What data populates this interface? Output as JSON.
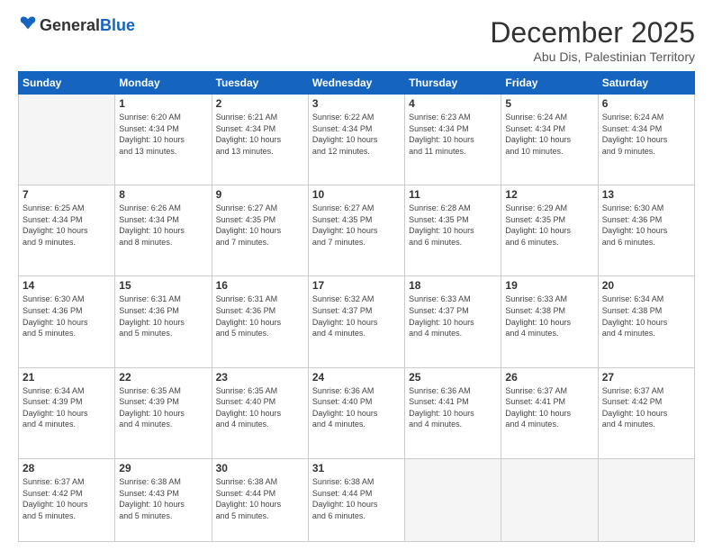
{
  "header": {
    "logo_general": "General",
    "logo_blue": "Blue",
    "month_title": "December 2025",
    "location": "Abu Dis, Palestinian Territory"
  },
  "days_of_week": [
    "Sunday",
    "Monday",
    "Tuesday",
    "Wednesday",
    "Thursday",
    "Friday",
    "Saturday"
  ],
  "weeks": [
    [
      {
        "day": "",
        "info": ""
      },
      {
        "day": "1",
        "info": "Sunrise: 6:20 AM\nSunset: 4:34 PM\nDaylight: 10 hours\nand 13 minutes."
      },
      {
        "day": "2",
        "info": "Sunrise: 6:21 AM\nSunset: 4:34 PM\nDaylight: 10 hours\nand 13 minutes."
      },
      {
        "day": "3",
        "info": "Sunrise: 6:22 AM\nSunset: 4:34 PM\nDaylight: 10 hours\nand 12 minutes."
      },
      {
        "day": "4",
        "info": "Sunrise: 6:23 AM\nSunset: 4:34 PM\nDaylight: 10 hours\nand 11 minutes."
      },
      {
        "day": "5",
        "info": "Sunrise: 6:24 AM\nSunset: 4:34 PM\nDaylight: 10 hours\nand 10 minutes."
      },
      {
        "day": "6",
        "info": "Sunrise: 6:24 AM\nSunset: 4:34 PM\nDaylight: 10 hours\nand 9 minutes."
      }
    ],
    [
      {
        "day": "7",
        "info": "Sunrise: 6:25 AM\nSunset: 4:34 PM\nDaylight: 10 hours\nand 9 minutes."
      },
      {
        "day": "8",
        "info": "Sunrise: 6:26 AM\nSunset: 4:34 PM\nDaylight: 10 hours\nand 8 minutes."
      },
      {
        "day": "9",
        "info": "Sunrise: 6:27 AM\nSunset: 4:35 PM\nDaylight: 10 hours\nand 7 minutes."
      },
      {
        "day": "10",
        "info": "Sunrise: 6:27 AM\nSunset: 4:35 PM\nDaylight: 10 hours\nand 7 minutes."
      },
      {
        "day": "11",
        "info": "Sunrise: 6:28 AM\nSunset: 4:35 PM\nDaylight: 10 hours\nand 6 minutes."
      },
      {
        "day": "12",
        "info": "Sunrise: 6:29 AM\nSunset: 4:35 PM\nDaylight: 10 hours\nand 6 minutes."
      },
      {
        "day": "13",
        "info": "Sunrise: 6:30 AM\nSunset: 4:36 PM\nDaylight: 10 hours\nand 6 minutes."
      }
    ],
    [
      {
        "day": "14",
        "info": "Sunrise: 6:30 AM\nSunset: 4:36 PM\nDaylight: 10 hours\nand 5 minutes."
      },
      {
        "day": "15",
        "info": "Sunrise: 6:31 AM\nSunset: 4:36 PM\nDaylight: 10 hours\nand 5 minutes."
      },
      {
        "day": "16",
        "info": "Sunrise: 6:31 AM\nSunset: 4:36 PM\nDaylight: 10 hours\nand 5 minutes."
      },
      {
        "day": "17",
        "info": "Sunrise: 6:32 AM\nSunset: 4:37 PM\nDaylight: 10 hours\nand 4 minutes."
      },
      {
        "day": "18",
        "info": "Sunrise: 6:33 AM\nSunset: 4:37 PM\nDaylight: 10 hours\nand 4 minutes."
      },
      {
        "day": "19",
        "info": "Sunrise: 6:33 AM\nSunset: 4:38 PM\nDaylight: 10 hours\nand 4 minutes."
      },
      {
        "day": "20",
        "info": "Sunrise: 6:34 AM\nSunset: 4:38 PM\nDaylight: 10 hours\nand 4 minutes."
      }
    ],
    [
      {
        "day": "21",
        "info": "Sunrise: 6:34 AM\nSunset: 4:39 PM\nDaylight: 10 hours\nand 4 minutes."
      },
      {
        "day": "22",
        "info": "Sunrise: 6:35 AM\nSunset: 4:39 PM\nDaylight: 10 hours\nand 4 minutes."
      },
      {
        "day": "23",
        "info": "Sunrise: 6:35 AM\nSunset: 4:40 PM\nDaylight: 10 hours\nand 4 minutes."
      },
      {
        "day": "24",
        "info": "Sunrise: 6:36 AM\nSunset: 4:40 PM\nDaylight: 10 hours\nand 4 minutes."
      },
      {
        "day": "25",
        "info": "Sunrise: 6:36 AM\nSunset: 4:41 PM\nDaylight: 10 hours\nand 4 minutes."
      },
      {
        "day": "26",
        "info": "Sunrise: 6:37 AM\nSunset: 4:41 PM\nDaylight: 10 hours\nand 4 minutes."
      },
      {
        "day": "27",
        "info": "Sunrise: 6:37 AM\nSunset: 4:42 PM\nDaylight: 10 hours\nand 4 minutes."
      }
    ],
    [
      {
        "day": "28",
        "info": "Sunrise: 6:37 AM\nSunset: 4:42 PM\nDaylight: 10 hours\nand 5 minutes."
      },
      {
        "day": "29",
        "info": "Sunrise: 6:38 AM\nSunset: 4:43 PM\nDaylight: 10 hours\nand 5 minutes."
      },
      {
        "day": "30",
        "info": "Sunrise: 6:38 AM\nSunset: 4:44 PM\nDaylight: 10 hours\nand 5 minutes."
      },
      {
        "day": "31",
        "info": "Sunrise: 6:38 AM\nSunset: 4:44 PM\nDaylight: 10 hours\nand 6 minutes."
      },
      {
        "day": "",
        "info": ""
      },
      {
        "day": "",
        "info": ""
      },
      {
        "day": "",
        "info": ""
      }
    ]
  ]
}
